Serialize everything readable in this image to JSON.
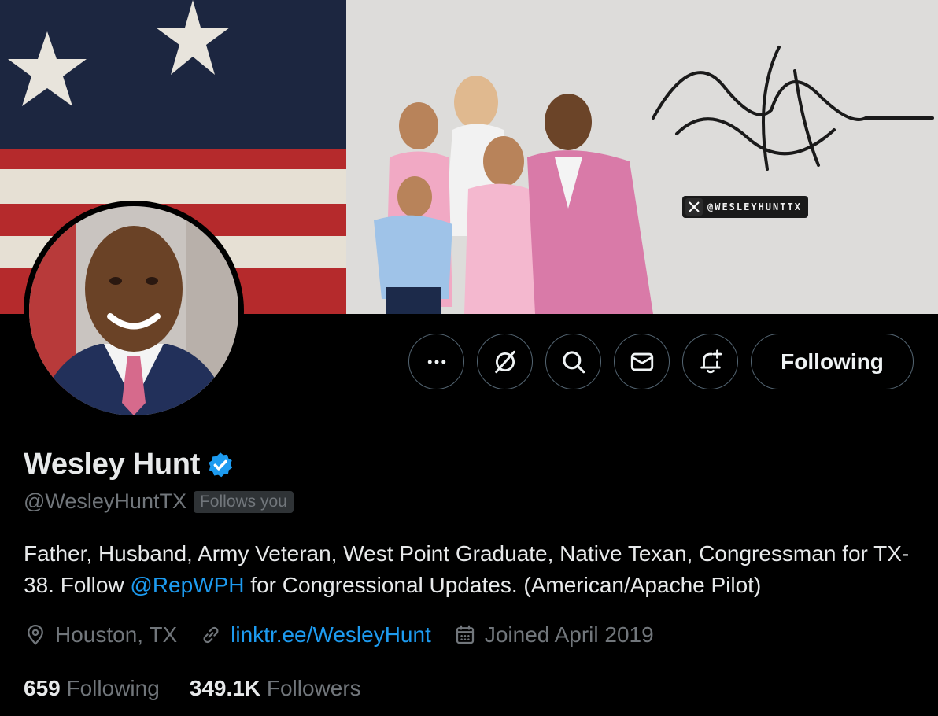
{
  "banner": {
    "watermark_text": "@WESLEYHUNTTX",
    "image": "family-photo-with-flag-and-signature"
  },
  "avatar": {
    "image": "profile-portrait"
  },
  "actions": {
    "more_icon": "ellipsis-icon",
    "grok_icon": "grok-icon",
    "search_icon": "search-icon",
    "message_icon": "envelope-icon",
    "notify_icon": "bell-plus-icon",
    "follow_label": "Following"
  },
  "profile": {
    "display_name": "Wesley Hunt",
    "verified_icon": "verified-badge-icon",
    "handle": "@WesleyHuntTX",
    "follows_you": "Follows you",
    "bio_part1": "Father, Husband, Army Veteran, West Point Graduate, Native Texan, Congressman for TX-38. Follow ",
    "bio_mention": "@RepWPH",
    "bio_part2": " for Congressional Updates. (American/Apache Pilot)",
    "location": "Houston, TX",
    "website": "linktr.ee/WesleyHunt",
    "joined": "Joined April 2019"
  },
  "stats": {
    "following_count": "659",
    "following_label": "Following",
    "followers_count": "349.1K",
    "followers_label": "Followers"
  },
  "colors": {
    "accent": "#1d9bf0",
    "muted": "#71767b",
    "text": "#e7e9ea",
    "border": "#536471"
  }
}
